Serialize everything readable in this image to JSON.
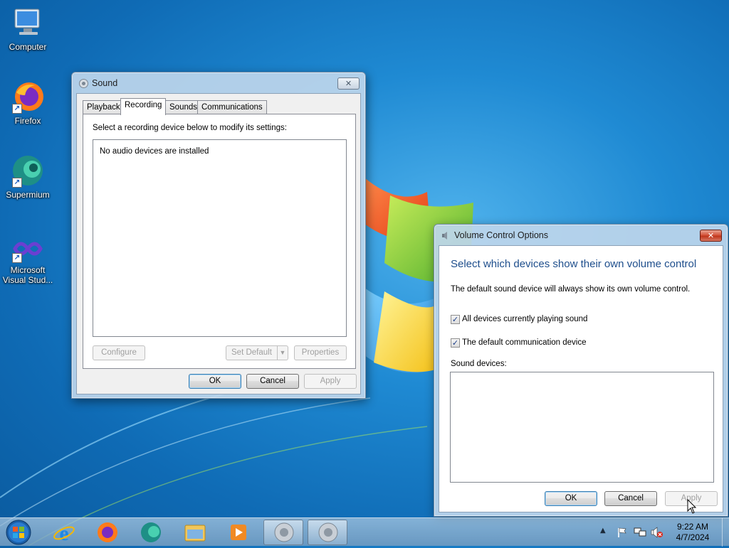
{
  "desktop": {
    "icons": [
      {
        "label": "Computer"
      },
      {
        "label": "Firefox"
      },
      {
        "label": "Supermium"
      },
      {
        "label": "Microsoft Visual Stud..."
      }
    ]
  },
  "sound_window": {
    "title": "Sound",
    "tabs": [
      "Playback",
      "Recording",
      "Sounds",
      "Communications"
    ],
    "active_tab": "Recording",
    "instruction": "Select a recording device below to modify its settings:",
    "empty_message": "No audio devices are installed",
    "configure_label": "Configure",
    "set_default_label": "Set Default",
    "properties_label": "Properties",
    "ok_label": "OK",
    "cancel_label": "Cancel",
    "apply_label": "Apply"
  },
  "volume_window": {
    "title": "Volume Control Options",
    "heading": "Select which devices show their own volume control",
    "description": "The default sound device will always show its own volume control.",
    "checkbox_playing": {
      "label": "All devices currently playing sound",
      "checked": true
    },
    "checkbox_communication": {
      "label": "The default communication device",
      "checked": true
    },
    "devices_label": "Sound devices:",
    "ok_label": "OK",
    "cancel_label": "Cancel",
    "apply_label": "Apply"
  },
  "taskbar": {
    "time": "9:22 AM",
    "date": "4/7/2024",
    "pinned": [
      "start-orb",
      "internet-explorer-icon",
      "firefox-icon",
      "supermium-icon",
      "file-explorer-icon",
      "media-player-icon",
      "sound-icon",
      "sound-icon"
    ]
  },
  "colors": {
    "heading_blue": "#1e4e8c",
    "desktop_blue": "#1f8ad3",
    "close_red": "#c0361c"
  }
}
